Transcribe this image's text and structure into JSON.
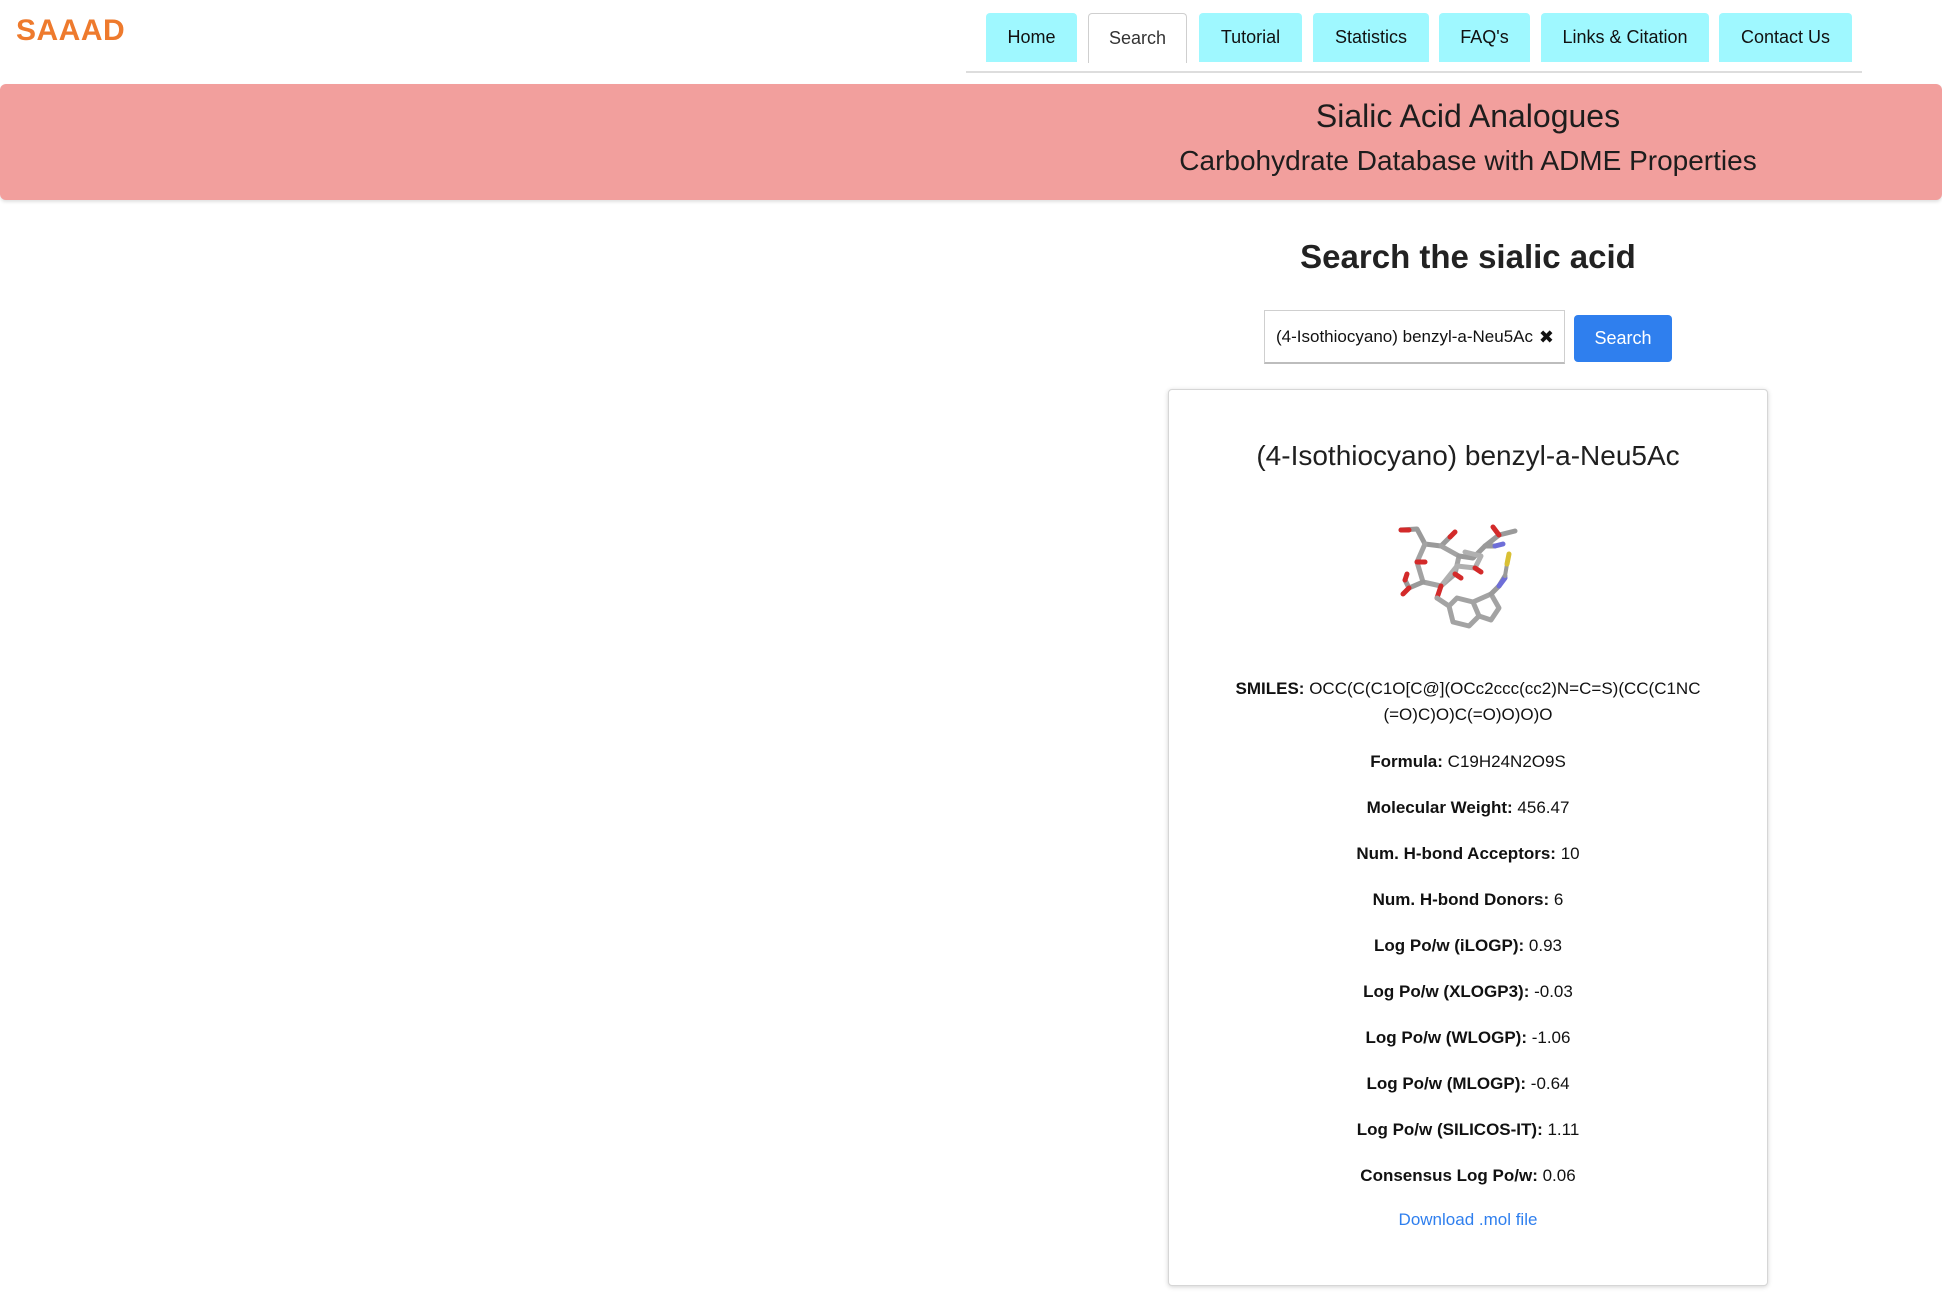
{
  "brand": {
    "logo": "SAAAD",
    "logo_color": "#ee7a2d"
  },
  "nav": {
    "tabs": [
      {
        "label": "Home",
        "active": false
      },
      {
        "label": "Search",
        "active": true
      },
      {
        "label": "Tutorial",
        "active": false
      },
      {
        "label": "Statistics",
        "active": false
      },
      {
        "label": "FAQ's",
        "active": false
      },
      {
        "label": "Links & Citation",
        "active": false
      },
      {
        "label": "Contact Us",
        "active": false
      }
    ],
    "tab_color": "#9ff8ff"
  },
  "banner": {
    "title": "Sialic Acid Analogues",
    "subtitle": "Carbohydrate Database with ADME Properties",
    "color": "#f29f9d"
  },
  "search": {
    "heading": "Search the sialic acid",
    "value": "(4-Isothiocyano) benzyl-a-Neu5Ac",
    "clear_icon": "close-icon",
    "button_label": "Search",
    "button_color": "#2f7fee"
  },
  "result": {
    "name": "(4-Isothiocyano) benzyl-a-Neu5Ac",
    "image_icon": "molecule-3d-structure",
    "properties": [
      {
        "label": "SMILES:",
        "value": "OCC(C(C1O[C@](OCc2ccc(cc2)N=C=S)(CC(C1NC(=O)C)O)C(=O)O)O)O"
      },
      {
        "label": "Formula:",
        "value": "C19H24N2O9S"
      },
      {
        "label": "Molecular Weight:",
        "value": "456.47"
      },
      {
        "label": "Num. H-bond Acceptors:",
        "value": "10"
      },
      {
        "label": "Num. H-bond Donors:",
        "value": "6"
      },
      {
        "label": "Log Po/w (iLOGP):",
        "value": "0.93"
      },
      {
        "label": "Log Po/w (XLOGP3):",
        "value": "-0.03"
      },
      {
        "label": "Log Po/w (WLOGP):",
        "value": "-1.06"
      },
      {
        "label": "Log Po/w (MLOGP):",
        "value": "-0.64"
      },
      {
        "label": "Log Po/w (SILICOS-IT):",
        "value": "1.11"
      },
      {
        "label": "Consensus Log Po/w:",
        "value": "0.06"
      }
    ],
    "download_label": "Download .mol file"
  }
}
